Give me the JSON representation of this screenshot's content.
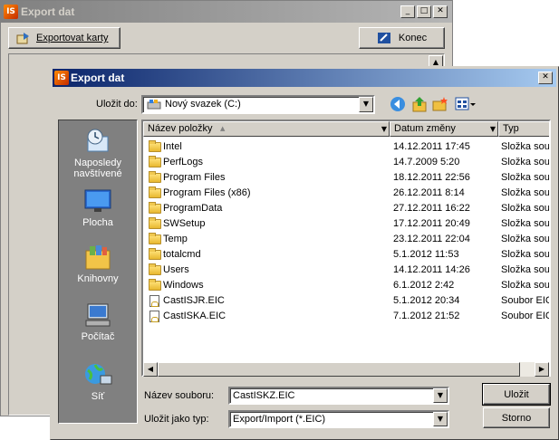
{
  "background_window": {
    "title": "Export dat",
    "buttons": {
      "minimize": "_",
      "maximize": "□",
      "close": "✕"
    },
    "export_button": "Exportovat karty",
    "end_button": "Konec",
    "scroll_up": "▲"
  },
  "dialog": {
    "title": "Export dat",
    "close": "✕",
    "save_in_label": "Uložit do:",
    "save_in_value": "Nový svazek (C:)",
    "places": [
      {
        "label": "Naposledy navštívené",
        "icon": "recent-places-icon"
      },
      {
        "label": "Plocha",
        "icon": "desktop-icon"
      },
      {
        "label": "Knihovny",
        "icon": "libraries-icon"
      },
      {
        "label": "Počítač",
        "icon": "computer-icon"
      },
      {
        "label": "Síť",
        "icon": "network-icon"
      }
    ],
    "columns": [
      "Název položky",
      "Datum změny",
      "Typ"
    ],
    "sort_arrow": "▲",
    "files": [
      {
        "name": "Intel",
        "date": "14.12.2011 17:45",
        "type": "Složka soub",
        "kind": "folder"
      },
      {
        "name": "PerfLogs",
        "date": "14.7.2009 5:20",
        "type": "Složka soub",
        "kind": "folder"
      },
      {
        "name": "Program Files",
        "date": "18.12.2011 22:56",
        "type": "Složka soub",
        "kind": "folder"
      },
      {
        "name": "Program Files (x86)",
        "date": "26.12.2011 8:14",
        "type": "Složka soub",
        "kind": "folder"
      },
      {
        "name": "ProgramData",
        "date": "27.12.2011 16:22",
        "type": "Složka soub",
        "kind": "folder"
      },
      {
        "name": "SWSetup",
        "date": "17.12.2011 20:49",
        "type": "Složka soub",
        "kind": "folder"
      },
      {
        "name": "Temp",
        "date": "23.12.2011 22:04",
        "type": "Složka soub",
        "kind": "folder"
      },
      {
        "name": "totalcmd",
        "date": "5.1.2012 11:53",
        "type": "Složka soub",
        "kind": "folder"
      },
      {
        "name": "Users",
        "date": "14.12.2011 14:26",
        "type": "Složka soub",
        "kind": "folder"
      },
      {
        "name": "Windows",
        "date": "6.1.2012 2:42",
        "type": "Složka soub",
        "kind": "folder"
      },
      {
        "name": "CastISJR.EIC",
        "date": "5.1.2012 20:34",
        "type": "Soubor EIC",
        "kind": "file"
      },
      {
        "name": "CastISKA.EIC",
        "date": "7.1.2012 21:52",
        "type": "Soubor EIC",
        "kind": "file"
      }
    ],
    "filename_label": "Název souboru:",
    "filename_value": "CastISKZ.EIC",
    "filetype_label": "Uložit jako typ:",
    "filetype_value": "Export/Import (*.EIC)",
    "save_button": "Uložit",
    "cancel_button": "Storno",
    "dropdown_arrow": "▼",
    "scroll_left": "◀",
    "scroll_right": "▶"
  },
  "colors": {
    "title_active": "#0a246a",
    "title_inactive": "#808080",
    "face": "#d4d0c8"
  }
}
